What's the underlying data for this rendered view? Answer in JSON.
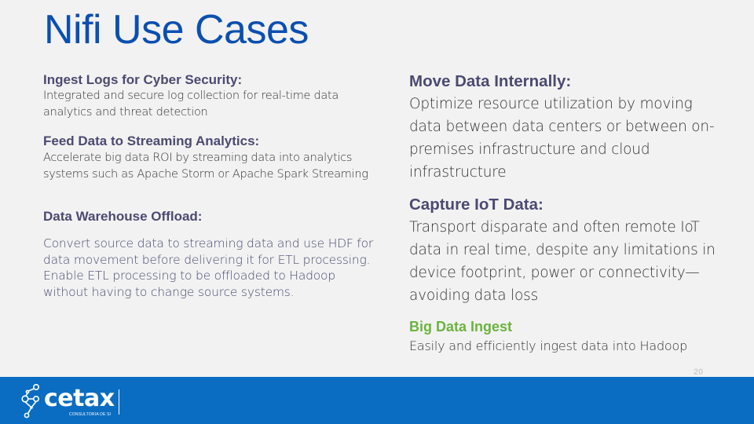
{
  "title": "Nifi Use Cases",
  "left": [
    {
      "heading": "Ingest Logs for Cyber Security:",
      "body": "Integrated and secure log collection for real-time data analytics and threat detection"
    },
    {
      "heading": "Feed Data to Streaming Analytics:",
      "body": "Accelerate big data ROI by streaming data into analytics systems such as Apache Storm or Apache Spark Streaming"
    },
    {
      "heading": "Data Warehouse Offload:",
      "body": "Convert source data to streaming data and use HDF for data movement before delivering it for ETL processing. Enable ETL processing to be offloaded to Hadoop without having to change source systems."
    }
  ],
  "right": [
    {
      "heading": "Move Data Internally:",
      "body": "Optimize resource utilization by moving data between data centers or between on-premises infrastructure and cloud infrastructure"
    },
    {
      "heading": "Capture IoT Data:",
      "body": "Transport disparate and often remote IoT data in real time, despite any limitations in device footprint, power or connectivity—avoiding data loss"
    },
    {
      "heading": "Big Data Ingest",
      "body": "Easily and efficiently ingest data into Hadoop"
    }
  ],
  "page_number": "20",
  "footer": {
    "logo_text": "cetax",
    "logo_subtitle": "CONSULTORIA DE SI",
    "logo_icon": "network-nodes-icon"
  },
  "colors": {
    "title": "#0b4fb0",
    "heading": "#4a4a72",
    "accent_green": "#6cb33f",
    "footer": "#0a6dc2"
  }
}
